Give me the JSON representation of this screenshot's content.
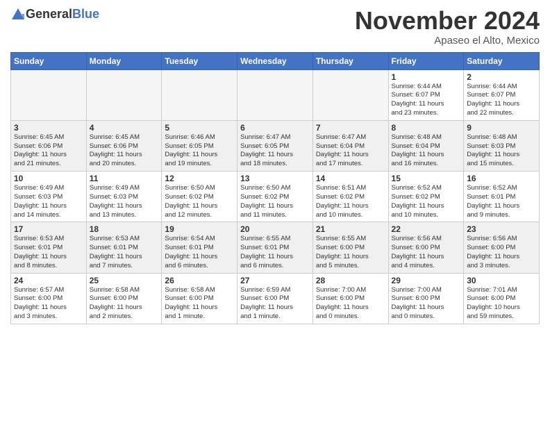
{
  "header": {
    "logo_general": "General",
    "logo_blue": "Blue",
    "month_title": "November 2024",
    "location": "Apaseo el Alto, Mexico"
  },
  "weekdays": [
    "Sunday",
    "Monday",
    "Tuesday",
    "Wednesday",
    "Thursday",
    "Friday",
    "Saturday"
  ],
  "weeks": [
    [
      {
        "day": "",
        "info": ""
      },
      {
        "day": "",
        "info": ""
      },
      {
        "day": "",
        "info": ""
      },
      {
        "day": "",
        "info": ""
      },
      {
        "day": "",
        "info": ""
      },
      {
        "day": "1",
        "info": "Sunrise: 6:44 AM\nSunset: 6:07 PM\nDaylight: 11 hours\nand 23 minutes."
      },
      {
        "day": "2",
        "info": "Sunrise: 6:44 AM\nSunset: 6:07 PM\nDaylight: 11 hours\nand 22 minutes."
      }
    ],
    [
      {
        "day": "3",
        "info": "Sunrise: 6:45 AM\nSunset: 6:06 PM\nDaylight: 11 hours\nand 21 minutes."
      },
      {
        "day": "4",
        "info": "Sunrise: 6:45 AM\nSunset: 6:06 PM\nDaylight: 11 hours\nand 20 minutes."
      },
      {
        "day": "5",
        "info": "Sunrise: 6:46 AM\nSunset: 6:05 PM\nDaylight: 11 hours\nand 19 minutes."
      },
      {
        "day": "6",
        "info": "Sunrise: 6:47 AM\nSunset: 6:05 PM\nDaylight: 11 hours\nand 18 minutes."
      },
      {
        "day": "7",
        "info": "Sunrise: 6:47 AM\nSunset: 6:04 PM\nDaylight: 11 hours\nand 17 minutes."
      },
      {
        "day": "8",
        "info": "Sunrise: 6:48 AM\nSunset: 6:04 PM\nDaylight: 11 hours\nand 16 minutes."
      },
      {
        "day": "9",
        "info": "Sunrise: 6:48 AM\nSunset: 6:03 PM\nDaylight: 11 hours\nand 15 minutes."
      }
    ],
    [
      {
        "day": "10",
        "info": "Sunrise: 6:49 AM\nSunset: 6:03 PM\nDaylight: 11 hours\nand 14 minutes."
      },
      {
        "day": "11",
        "info": "Sunrise: 6:49 AM\nSunset: 6:03 PM\nDaylight: 11 hours\nand 13 minutes."
      },
      {
        "day": "12",
        "info": "Sunrise: 6:50 AM\nSunset: 6:02 PM\nDaylight: 11 hours\nand 12 minutes."
      },
      {
        "day": "13",
        "info": "Sunrise: 6:50 AM\nSunset: 6:02 PM\nDaylight: 11 hours\nand 11 minutes."
      },
      {
        "day": "14",
        "info": "Sunrise: 6:51 AM\nSunset: 6:02 PM\nDaylight: 11 hours\nand 10 minutes."
      },
      {
        "day": "15",
        "info": "Sunrise: 6:52 AM\nSunset: 6:02 PM\nDaylight: 11 hours\nand 10 minutes."
      },
      {
        "day": "16",
        "info": "Sunrise: 6:52 AM\nSunset: 6:01 PM\nDaylight: 11 hours\nand 9 minutes."
      }
    ],
    [
      {
        "day": "17",
        "info": "Sunrise: 6:53 AM\nSunset: 6:01 PM\nDaylight: 11 hours\nand 8 minutes."
      },
      {
        "day": "18",
        "info": "Sunrise: 6:53 AM\nSunset: 6:01 PM\nDaylight: 11 hours\nand 7 minutes."
      },
      {
        "day": "19",
        "info": "Sunrise: 6:54 AM\nSunset: 6:01 PM\nDaylight: 11 hours\nand 6 minutes."
      },
      {
        "day": "20",
        "info": "Sunrise: 6:55 AM\nSunset: 6:01 PM\nDaylight: 11 hours\nand 6 minutes."
      },
      {
        "day": "21",
        "info": "Sunrise: 6:55 AM\nSunset: 6:00 PM\nDaylight: 11 hours\nand 5 minutes."
      },
      {
        "day": "22",
        "info": "Sunrise: 6:56 AM\nSunset: 6:00 PM\nDaylight: 11 hours\nand 4 minutes."
      },
      {
        "day": "23",
        "info": "Sunrise: 6:56 AM\nSunset: 6:00 PM\nDaylight: 11 hours\nand 3 minutes."
      }
    ],
    [
      {
        "day": "24",
        "info": "Sunrise: 6:57 AM\nSunset: 6:00 PM\nDaylight: 11 hours\nand 3 minutes."
      },
      {
        "day": "25",
        "info": "Sunrise: 6:58 AM\nSunset: 6:00 PM\nDaylight: 11 hours\nand 2 minutes."
      },
      {
        "day": "26",
        "info": "Sunrise: 6:58 AM\nSunset: 6:00 PM\nDaylight: 11 hours\nand 1 minute."
      },
      {
        "day": "27",
        "info": "Sunrise: 6:59 AM\nSunset: 6:00 PM\nDaylight: 11 hours\nand 1 minute."
      },
      {
        "day": "28",
        "info": "Sunrise: 7:00 AM\nSunset: 6:00 PM\nDaylight: 11 hours\nand 0 minutes."
      },
      {
        "day": "29",
        "info": "Sunrise: 7:00 AM\nSunset: 6:00 PM\nDaylight: 11 hours\nand 0 minutes."
      },
      {
        "day": "30",
        "info": "Sunrise: 7:01 AM\nSunset: 6:00 PM\nDaylight: 10 hours\nand 59 minutes."
      }
    ]
  ]
}
